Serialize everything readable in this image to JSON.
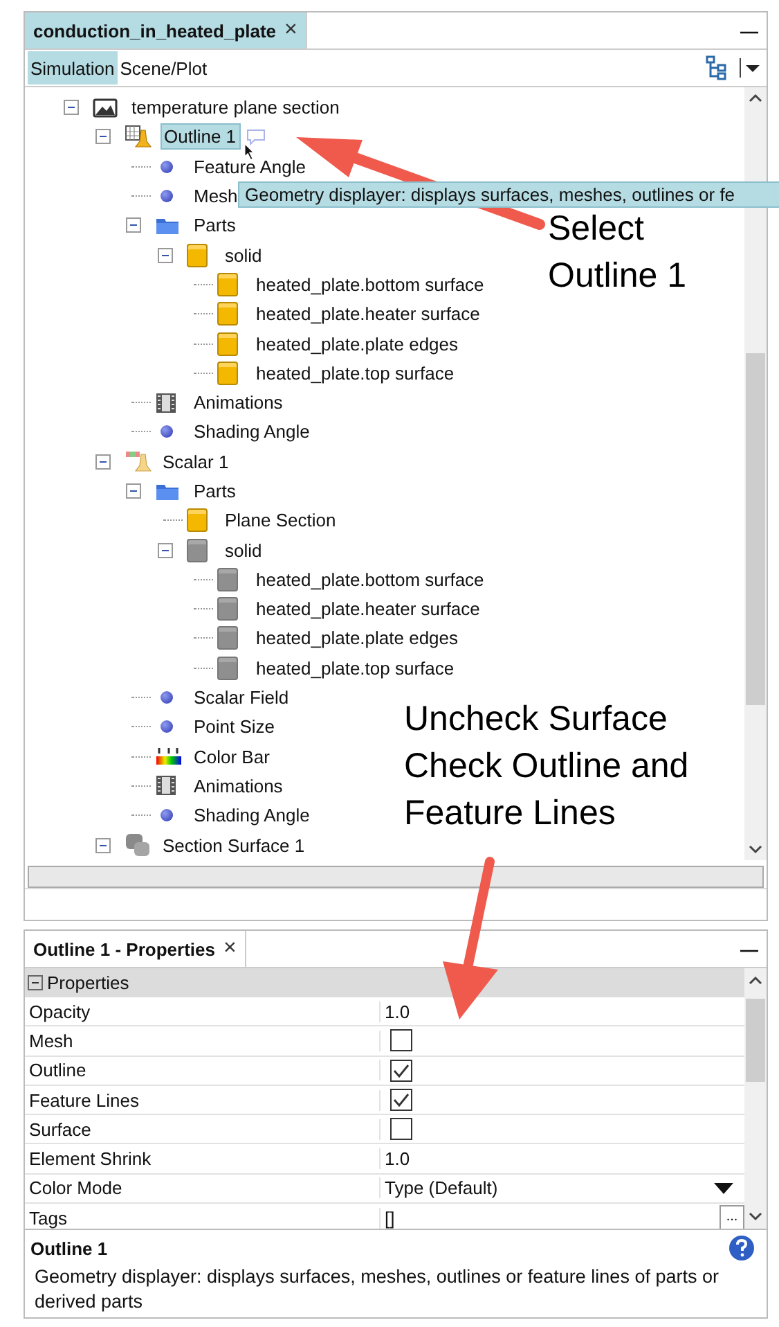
{
  "window": {
    "tab": {
      "title": "conduction_in_heated_plate",
      "close": "×",
      "selected": true
    },
    "minimize": "—"
  },
  "subtabs": [
    {
      "label": "Simulation",
      "selected": true
    },
    {
      "label": "Scene/Plot",
      "selected": false
    }
  ],
  "tree": [
    {
      "label": "temperature plane section",
      "kind": "scene",
      "expanded": true,
      "selected": false,
      "children": [
        {
          "label": "Outline 1",
          "kind": "outline",
          "expanded": true,
          "selected": true,
          "comment": true,
          "children": [
            {
              "label": "Feature Angle",
              "kind": "dot"
            },
            {
              "label": "Mesh",
              "kind": "dot"
            },
            {
              "label": "Parts",
              "kind": "folder",
              "expanded": true,
              "children": [
                {
                  "label": "solid",
                  "kind": "part",
                  "expanded": true,
                  "children": [
                    {
                      "label": "heated_plate.bottom surface",
                      "kind": "part"
                    },
                    {
                      "label": "heated_plate.heater surface",
                      "kind": "part"
                    },
                    {
                      "label": "heated_plate.plate edges",
                      "kind": "part"
                    },
                    {
                      "label": "heated_plate.top surface",
                      "kind": "part"
                    }
                  ]
                }
              ]
            },
            {
              "label": "Animations",
              "kind": "film"
            },
            {
              "label": "Shading Angle",
              "kind": "dot"
            }
          ]
        },
        {
          "label": "Scalar 1",
          "kind": "scalar",
          "expanded": true,
          "selected": false,
          "children": [
            {
              "label": "Parts",
              "kind": "folder",
              "expanded": true,
              "children": [
                {
                  "label": "Plane Section",
                  "kind": "part"
                },
                {
                  "label": "solid",
                  "kind": "part-off",
                  "expanded": true,
                  "children": [
                    {
                      "label": "heated_plate.bottom surface",
                      "kind": "part-off"
                    },
                    {
                      "label": "heated_plate.heater surface",
                      "kind": "part-off"
                    },
                    {
                      "label": "heated_plate.plate edges",
                      "kind": "part-off"
                    },
                    {
                      "label": "heated_plate.top surface",
                      "kind": "part-off"
                    }
                  ]
                }
              ]
            },
            {
              "label": "Scalar Field",
              "kind": "dot"
            },
            {
              "label": "Point Size",
              "kind": "dot"
            },
            {
              "label": "Color Bar",
              "kind": "colorbar"
            },
            {
              "label": "Animations",
              "kind": "film"
            },
            {
              "label": "Shading Angle",
              "kind": "dot"
            }
          ]
        },
        {
          "label": "Section Surface 1",
          "kind": "section",
          "expanded": true,
          "selected": false
        }
      ]
    }
  ],
  "tooltip": "Geometry displayer: displays surfaces, meshes, outlines or fe",
  "properties_panel": {
    "tab": {
      "title": "Outline 1 - Properties",
      "close": "×"
    },
    "minimize": "—",
    "group": "Properties",
    "rows": [
      {
        "name": "Opacity",
        "kind": "text",
        "value": "1.0"
      },
      {
        "name": "Mesh",
        "kind": "checkbox",
        "checked": false
      },
      {
        "name": "Outline",
        "kind": "checkbox",
        "checked": true
      },
      {
        "name": "Feature Lines",
        "kind": "checkbox",
        "checked": true
      },
      {
        "name": "Surface",
        "kind": "checkbox",
        "checked": false
      },
      {
        "name": "Element Shrink",
        "kind": "text",
        "value": "1.0"
      },
      {
        "name": "Color Mode",
        "kind": "dropdown",
        "value": "Type (Default)"
      },
      {
        "name": "Tags",
        "kind": "button",
        "value": "[]",
        "button_label": "..."
      }
    ]
  },
  "description": {
    "title": "Outline 1",
    "text": "Geometry displayer: displays surfaces, meshes, outlines or feature lines of parts or derived parts"
  },
  "annotations": [
    {
      "text": "Select Outline 1"
    },
    {
      "text": "Uncheck Surface Check Outline and Feature Lines"
    }
  ]
}
